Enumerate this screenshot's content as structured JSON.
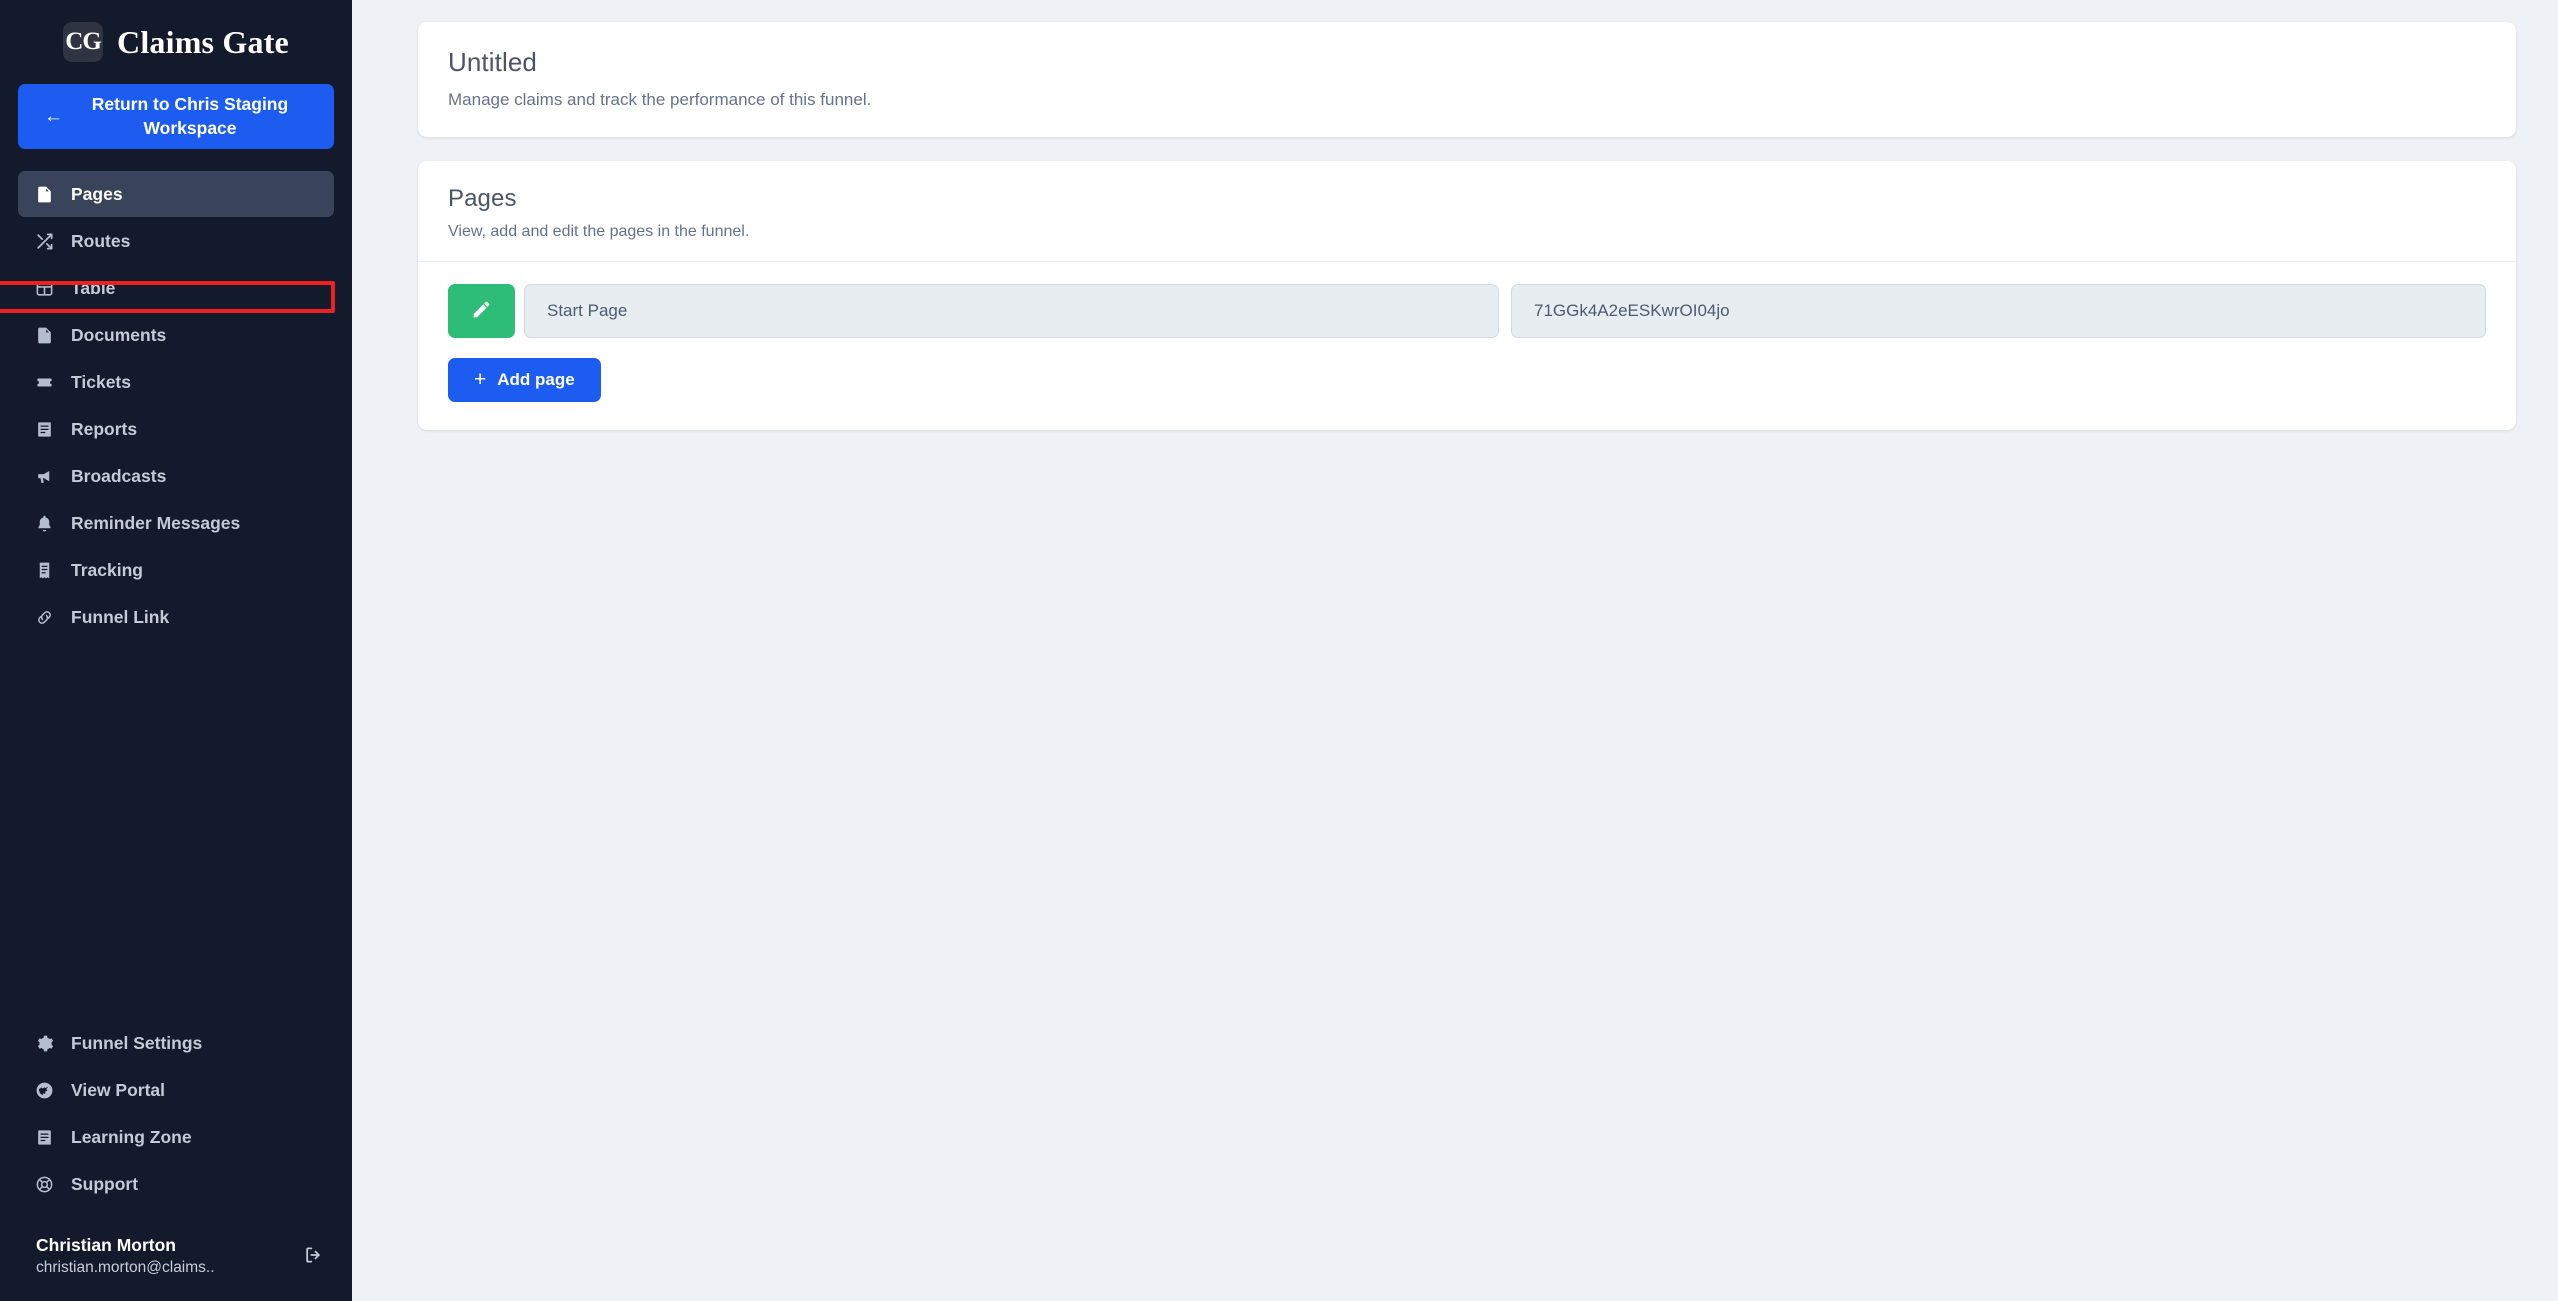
{
  "sidebar": {
    "brand": {
      "mark": "CG",
      "name": "Claims Gate"
    },
    "return_button": {
      "arrow": "←",
      "label": "Return to Chris Staging Workspace"
    },
    "items": [
      {
        "label": "Pages",
        "icon": "document-icon",
        "active": true
      },
      {
        "label": "Routes",
        "icon": "shuffle-icon",
        "active": false
      },
      {
        "label": "Table",
        "icon": "table-icon",
        "active": false
      },
      {
        "label": "Documents",
        "icon": "document-icon",
        "active": false
      },
      {
        "label": "Tickets",
        "icon": "ticket-icon",
        "active": false
      },
      {
        "label": "Reports",
        "icon": "report-icon",
        "active": false
      },
      {
        "label": "Broadcasts",
        "icon": "megaphone-icon",
        "active": false
      },
      {
        "label": "Reminder Messages",
        "icon": "bell-icon",
        "active": false
      },
      {
        "label": "Tracking",
        "icon": "receipt-icon",
        "active": false
      },
      {
        "label": "Funnel Link",
        "icon": "link-icon",
        "active": false
      }
    ],
    "bottom_items": [
      {
        "label": "Funnel Settings",
        "icon": "gear-icon"
      },
      {
        "label": "View Portal",
        "icon": "globe-icon"
      },
      {
        "label": "Learning Zone",
        "icon": "book-icon"
      },
      {
        "label": "Support",
        "icon": "lifebuoy-icon"
      }
    ],
    "user": {
      "name": "Christian Morton",
      "email": "christian.morton@claims..",
      "logout_icon": "logout-icon"
    }
  },
  "header_card": {
    "title": "Untitled",
    "subtitle": "Manage claims and track the performance of this funnel."
  },
  "pages_card": {
    "title": "Pages",
    "subtitle": "View, add and edit the pages in the funnel.",
    "rows": [
      {
        "edit_icon": "pencil-icon",
        "name_placeholder": "Start Page",
        "name_value": "",
        "page_id": "71GGk4A2eESKwrOI04jo"
      }
    ],
    "add_button": {
      "plus": "+",
      "label": "Add page"
    }
  },
  "annotation": {
    "highlight_target": "Table",
    "color": "#ef2020"
  },
  "colors": {
    "sidebar_bg": "#131a2b",
    "sidebar_active": "#39435a",
    "primary_blue": "#1d5cf0",
    "edit_green": "#2ebd78",
    "page_bg": "#eef1f5",
    "card_bg": "#ffffff"
  }
}
